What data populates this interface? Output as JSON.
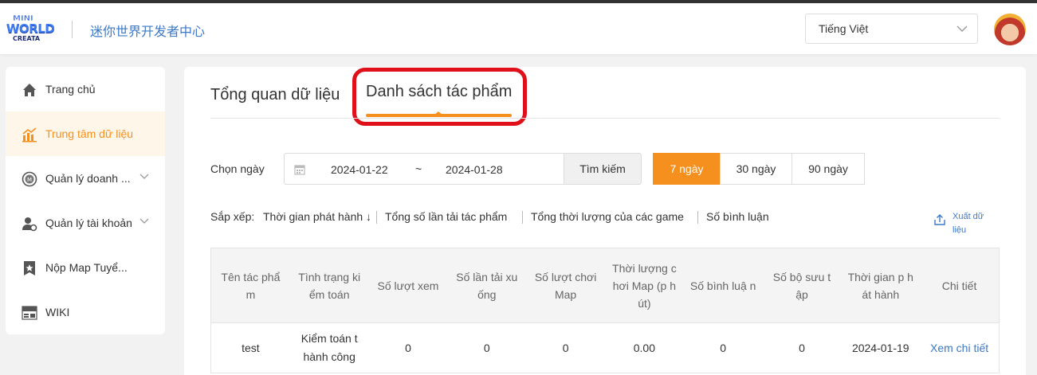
{
  "header": {
    "logo": {
      "line1": "MINI",
      "line2": "WORLD",
      "line3": "CREATA"
    },
    "site_title": "迷你世界开发者中心",
    "language": "Tiếng Việt"
  },
  "sidebar": {
    "items": [
      {
        "label": "Trang chủ",
        "icon": "home-icon"
      },
      {
        "label": "Trung tâm dữ liệu",
        "icon": "chart-icon",
        "active": true
      },
      {
        "label": "Quản lý doanh ...",
        "icon": "coin-icon",
        "expandable": true
      },
      {
        "label": "Quản lý tài khoản",
        "icon": "user-gear-icon",
        "expandable": true
      },
      {
        "label": "Nộp Map Tuyể...",
        "icon": "star-badge-icon"
      },
      {
        "label": "WIKI",
        "icon": "wiki-icon"
      }
    ]
  },
  "tabs": [
    {
      "label": "Tổng quan dữ liệu"
    },
    {
      "label": "Danh sách tác phẩm",
      "active": true
    }
  ],
  "filter": {
    "date_label": "Chọn ngày",
    "start_date": "2024-01-22",
    "separator": "~",
    "end_date": "2024-01-28",
    "search_label": "Tìm kiếm",
    "ranges": [
      "7 ngày",
      "30 ngày",
      "90 ngày"
    ],
    "active_range": "7 ngày"
  },
  "sort": {
    "label": "Sắp xếp:",
    "options": [
      "Thời gian phát hành ↓",
      "Tổng số lần tải tác phẩm",
      "Tổng thời lượng của các game",
      "Số bình luận"
    ]
  },
  "export": {
    "label_line1": "Xuất dữ",
    "label_line2": "liệu"
  },
  "table": {
    "headers": [
      "Tên tác phẩm",
      "Tình trạng ki ểm toán",
      "Số lượt xem",
      "Số lần tải xu ống",
      "Số lượt chơi Map",
      "Thời lượng chơi Map (p hút)",
      "Số bình luậ n",
      "Số bộ sưu t ập",
      "Thời gian p hát hành",
      "Chi tiết"
    ],
    "rows": [
      [
        "test",
        "Kiểm toán t hành công",
        "0",
        "0",
        "0",
        "0.00",
        "0",
        "0",
        "2024-01-19",
        "Xem chi tiết"
      ]
    ]
  },
  "colors": {
    "accent": "#f5901e",
    "link": "#3c78c8",
    "highlight": "#e0101a"
  }
}
